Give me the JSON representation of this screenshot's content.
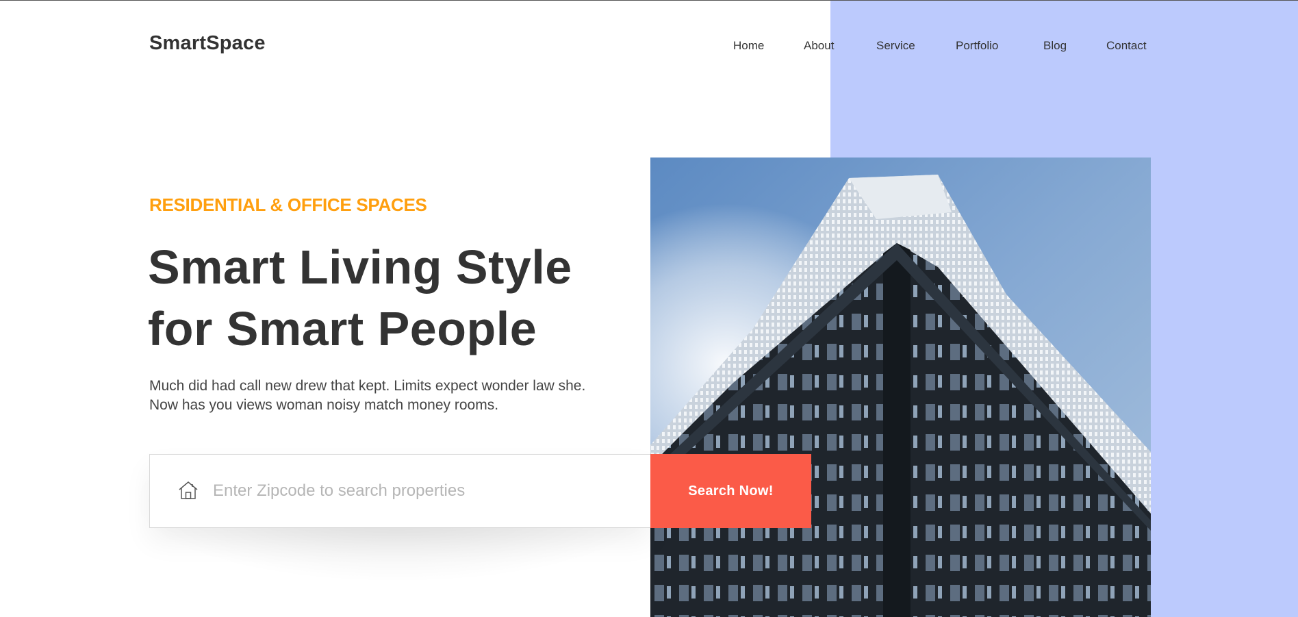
{
  "brand": {
    "name": "SmartSpace"
  },
  "nav": {
    "items": [
      {
        "label": "Home"
      },
      {
        "label": "About"
      },
      {
        "label": "Service"
      },
      {
        "label": "Portfolio"
      },
      {
        "label": "Blog"
      },
      {
        "label": "Contact"
      }
    ]
  },
  "hero": {
    "eyebrow": "RESIDENTIAL & OFFICE SPACES",
    "title_line1": "Smart Living Style",
    "title_line2": "for Smart People",
    "description": "Much did had call new drew that kept. Limits expect wonder law she. Now has you views woman noisy match money rooms.",
    "image_name": "skyscraper-photo"
  },
  "search": {
    "icon": "house-icon",
    "placeholder": "Enter Zipcode to search properties",
    "value": "",
    "button_label": "Search Now!"
  },
  "colors": {
    "accent_panel": "#bccafd",
    "eyebrow": "#ff9f0f",
    "button": "#fb5b48",
    "text": "#333333"
  }
}
